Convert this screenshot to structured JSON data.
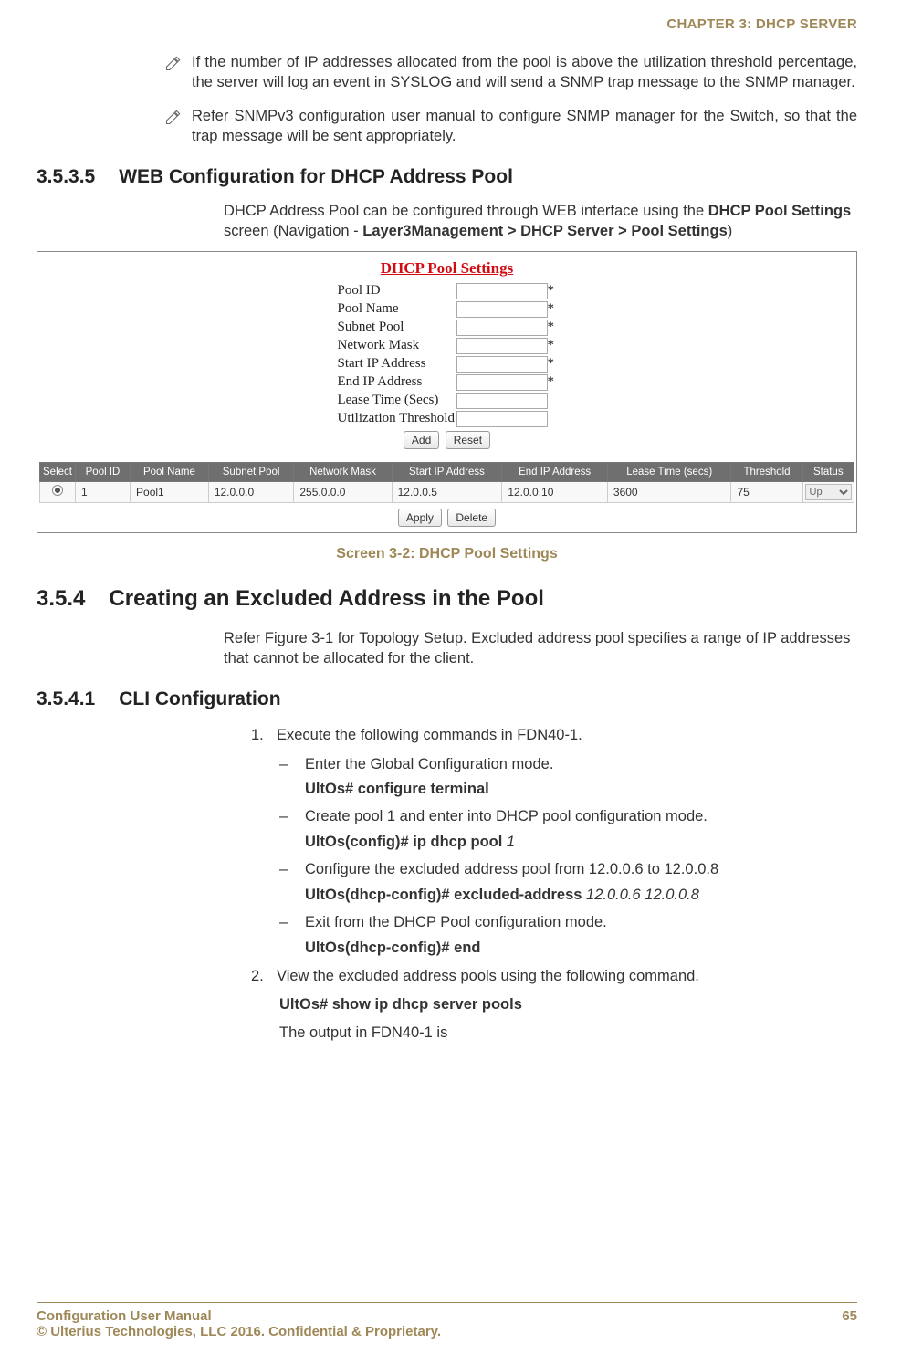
{
  "header": {
    "chapter": "CHAPTER 3: DHCP SERVER"
  },
  "notes": {
    "n1": "If the number of IP addresses allocated from the pool is above the utilization threshold percentage, the server will log an event in SYSLOG and will send a SNMP trap message to the SNMP manager.",
    "n2": "Refer SNMPv3 configuration user manual to configure SNMP manager for the Switch, so that the trap message will be sent appropriately."
  },
  "sec1": {
    "num": "3.5.3.5",
    "title": "WEB Configuration for DHCP Address Pool",
    "body_pre": "DHCP Address Pool can be configured through WEB interface using the ",
    "body_b1": "DHCP Pool Settings",
    "body_mid": " screen (Navigation - ",
    "body_b2": "Layer3Management > DHCP Server > Pool Settings",
    "body_post": ")"
  },
  "figure": {
    "title": "DHCP Pool Settings",
    "fields": {
      "pool_id": "Pool ID",
      "pool_name": "Pool Name",
      "subnet_pool": "Subnet Pool",
      "network_mask": "Network Mask",
      "start_ip": "Start IP Address",
      "end_ip": "End IP Address",
      "lease_time": "Lease Time (Secs)",
      "util_thresh": "Utilization Threshold"
    },
    "asterisk": "*",
    "buttons": {
      "add": "Add",
      "reset": "Reset",
      "apply": "Apply",
      "delete": "Delete"
    },
    "headers": {
      "select": "Select",
      "pool_id": "Pool ID",
      "pool_name": "Pool Name",
      "subnet_pool": "Subnet Pool",
      "network_mask": "Network Mask",
      "start_ip": "Start IP Address",
      "end_ip": "End IP Address",
      "lease_time": "Lease Time (secs)",
      "threshold": "Threshold",
      "status": "Status"
    },
    "row": {
      "pool_id": "1",
      "pool_name": "Pool1",
      "subnet_pool": "12.0.0.0",
      "network_mask": "255.0.0.0",
      "start_ip": "12.0.0.5",
      "end_ip": "12.0.0.10",
      "lease_time": "3600",
      "threshold": "75",
      "status": "Up"
    },
    "caption": "Screen 3-2: DHCP Pool Settings"
  },
  "sec2": {
    "num": "3.5.4",
    "title": "Creating an Excluded Address in the Pool",
    "body": "Refer Figure 3-1 for Topology Setup. Excluded address pool specifies a range of IP addresses that cannot be allocated for the client."
  },
  "sec3": {
    "num": "3.5.4.1",
    "title": "CLI Configuration",
    "step1_num": "1.",
    "step1": "Execute the following commands in FDN40-1.",
    "dash": "–",
    "d1": "Enter the Global Configuration mode.",
    "cmd1": "UltOs# configure terminal",
    "d2": "Create pool 1 and enter into DHCP pool configuration mode.",
    "cmd2_a": "UltOs(config)# ip dhcp pool ",
    "cmd2_b": "1",
    "d3": "Configure the excluded address pool from 12.0.0.6 to 12.0.0.8",
    "cmd3_a": "UltOs(dhcp-config)# excluded-address ",
    "cmd3_b": "12.0.0.6 12.0.0.8",
    "d4": "Exit from the DHCP Pool configuration mode.",
    "cmd4": "UltOs(dhcp-config)# end",
    "step2_num": "2.",
    "step2": "View the excluded address pools using the following command.",
    "cmd5": "UltOs# show ip dhcp server pools",
    "out": "The output in FDN40-1 is"
  },
  "footer": {
    "l1": "Configuration User Manual",
    "l2": "© Ulterius Technologies, LLC 2016. Confidential & Proprietary.",
    "page": "65"
  }
}
